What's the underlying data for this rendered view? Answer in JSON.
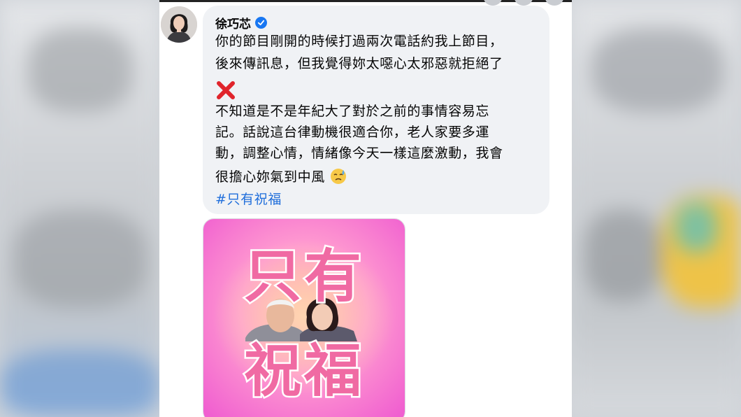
{
  "comment": {
    "author": "徐巧芯",
    "lines": [
      "你的節目剛開的時候打過兩次電話約我上節目，",
      "後來傳訊息，但我覺得妳太噁心太邪惡就拒絕了",
      "不知道是不是年紀大了對於之前的事情容易忘",
      "記。話說這台律動機很適合你，老人家要多運",
      "動，調整心情，情緒像今天一樣這麼激動，我會",
      "很擔心妳氣到中風"
    ],
    "hashtag": "#只有祝福"
  },
  "image_card": {
    "title_top": "只有",
    "title_bottom": "祝福"
  },
  "colors": {
    "bubble_bg": "#f0f2f5",
    "link": "#216fdb",
    "verified": "#1877f2",
    "x_mark": "#e0242b",
    "card_text": "#f06aa3"
  },
  "icons": [
    "verified-badge-icon",
    "red-x-icon",
    "sweat-face-emoji-icon"
  ]
}
